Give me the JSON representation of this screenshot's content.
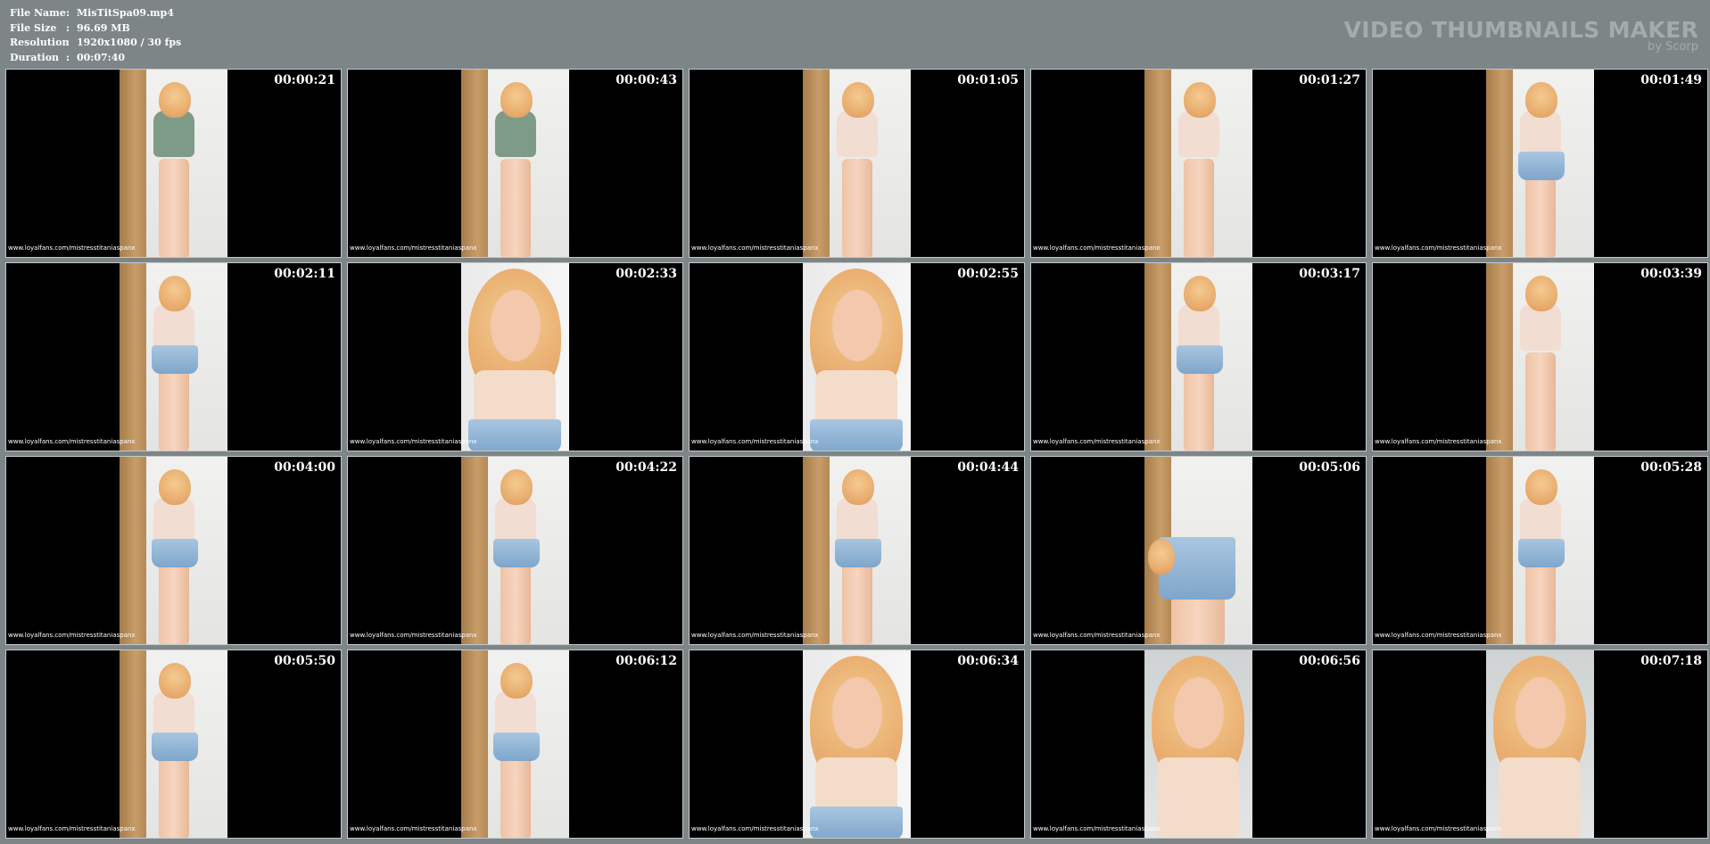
{
  "file_info": {
    "rows": [
      {
        "key": "File Name",
        "sep": ":",
        "value": "MisTitSpa09.mp4"
      },
      {
        "key": "File Size",
        "sep": ":",
        "value": "96.69 MB"
      },
      {
        "key": "Resolution",
        "sep": ":",
        "value": "1920x1080 / 30 fps"
      },
      {
        "key": "Duration",
        "sep": ":",
        "value": "00:07:40"
      }
    ]
  },
  "brand": {
    "title": "VIDEO THUMBNAILS MAKER",
    "subtitle": "by Scorp"
  },
  "watermark": "www.loyalfans.com/mistresstitaniaspanx",
  "thumbnails": [
    {
      "time": "00:00:21",
      "scene": "hall-green"
    },
    {
      "time": "00:00:43",
      "scene": "hall-green"
    },
    {
      "time": "00:01:05",
      "scene": "hall-body"
    },
    {
      "time": "00:01:27",
      "scene": "hall-body"
    },
    {
      "time": "00:01:49",
      "scene": "hall-denim"
    },
    {
      "time": "00:02:11",
      "scene": "hall-denim"
    },
    {
      "time": "00:02:33",
      "scene": "closeup"
    },
    {
      "time": "00:02:55",
      "scene": "closeup"
    },
    {
      "time": "00:03:17",
      "scene": "hall-denim"
    },
    {
      "time": "00:03:39",
      "scene": "hall-body"
    },
    {
      "time": "00:04:00",
      "scene": "hall-denim"
    },
    {
      "time": "00:04:22",
      "scene": "hall-denim"
    },
    {
      "time": "00:04:44",
      "scene": "hall-denim"
    },
    {
      "time": "00:05:06",
      "scene": "bend"
    },
    {
      "time": "00:05:28",
      "scene": "hall-denim"
    },
    {
      "time": "00:05:50",
      "scene": "hall-denim"
    },
    {
      "time": "00:06:12",
      "scene": "hall-denim"
    },
    {
      "time": "00:06:34",
      "scene": "closeup"
    },
    {
      "time": "00:06:56",
      "scene": "face-grey"
    },
    {
      "time": "00:07:18",
      "scene": "face-grey"
    }
  ]
}
